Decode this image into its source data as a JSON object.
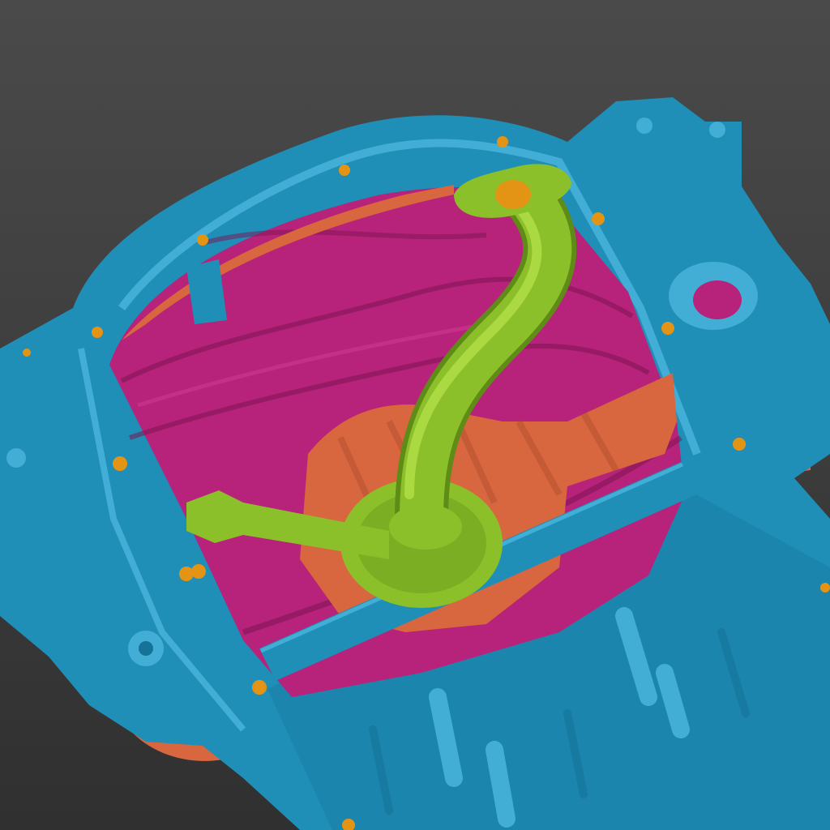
{
  "viewport": {
    "background_top": "#4a4a4a",
    "background_bottom": "#303030"
  },
  "model": {
    "segments": [
      {
        "name": "oil-pan-housing",
        "color": "#1f8fb8",
        "shade": "#157397",
        "highlight": "#42aed6"
      },
      {
        "name": "oil-pan-floor",
        "color": "#b7227a",
        "shade": "#7d1452",
        "highlight": "#d13d93"
      },
      {
        "name": "sump-well",
        "color": "#d8663f",
        "shade": "#b04e2c",
        "highlight": "#ea8257"
      },
      {
        "name": "oil-pickup-tube",
        "color": "#8cc02a",
        "shade": "#5f8c16",
        "highlight": "#b3df48"
      },
      {
        "name": "fastener-holes",
        "color": "#e49414",
        "shade": "#9a5f0b",
        "highlight": "#f7b84a"
      }
    ]
  }
}
